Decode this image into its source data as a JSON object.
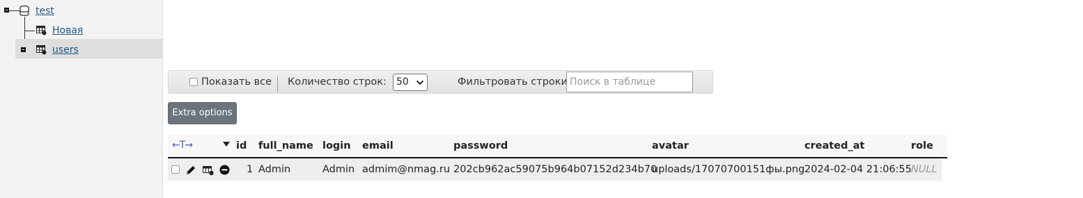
{
  "sidebar": {
    "db_name": "test",
    "tables": [
      {
        "label": "Новая"
      },
      {
        "label": "users"
      }
    ]
  },
  "toolbar": {
    "show_all_label": "Показать все",
    "rows_label": "Количество строк:",
    "rows_value": "50",
    "filter_label": "Фильтровать строки:",
    "filter_placeholder": "Поиск в таблице",
    "extra_options_label": "Extra options"
  },
  "table": {
    "columns": [
      "id",
      "full_name",
      "login",
      "email",
      "password",
      "avatar",
      "created_at",
      "role"
    ],
    "rows": [
      [
        "1",
        "Admin",
        "Admin",
        "admim@nmag.ru",
        "202cb962ac59075b964b07152d234b70",
        "uploads/17070700151фы.png",
        "2024-02-04 21:06:55",
        "NULL"
      ]
    ]
  },
  "colors": {
    "link": "#235a81",
    "button": "#6c757d",
    "arrows": "#4b63b6"
  },
  "icons": [
    "database-icon",
    "table-icon",
    "expand-icon",
    "edit-icon",
    "copy-icon",
    "delete-icon",
    "sort-arrows-icon",
    "sort-desc-icon"
  ]
}
